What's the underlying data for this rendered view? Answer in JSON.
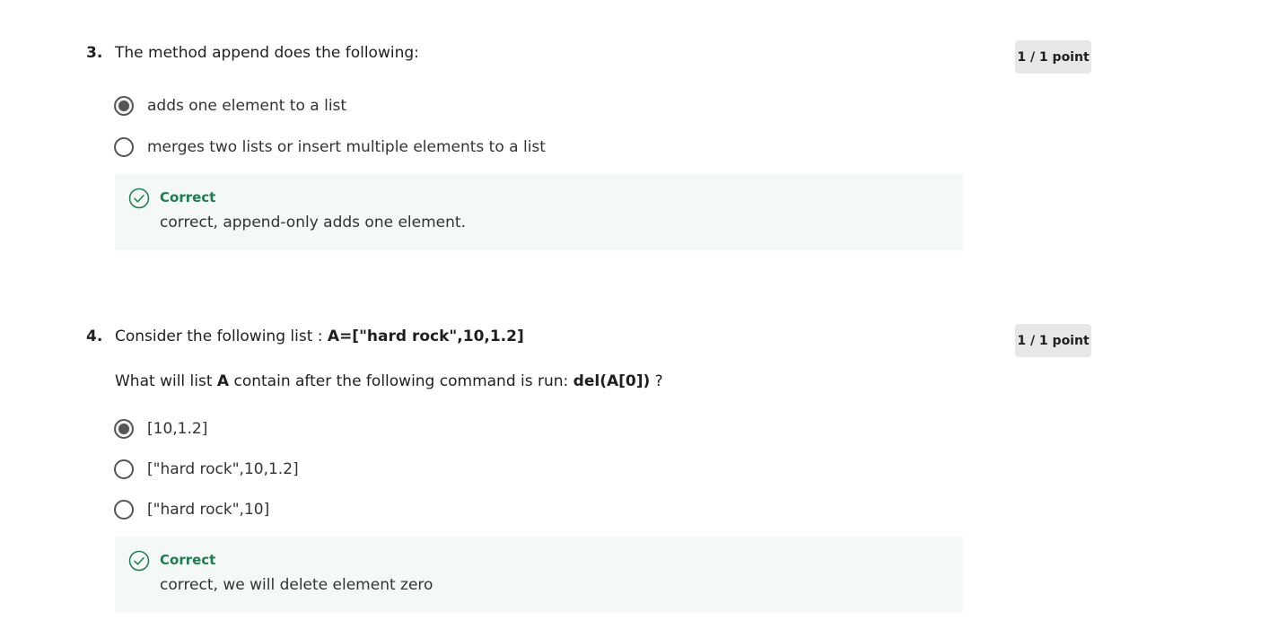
{
  "questions": [
    {
      "number": "3.",
      "prompt": "The method append does the following:",
      "points": "1 / 1 point",
      "options": [
        {
          "label": "adds one element to a list",
          "selected": true
        },
        {
          "label": "merges two lists or insert multiple elements to a list",
          "selected": false
        }
      ],
      "feedback": {
        "title": "Correct",
        "text": "correct, append-only adds one element."
      }
    },
    {
      "number": "4.",
      "prompt_prefix": "Consider the following list : ",
      "prompt_code": "A=[\"hard rock\",10,1.2]",
      "sub_prefix": "What will list ",
      "sub_var": "A",
      "sub_middle": " contain after the following command is run: ",
      "sub_code": "del(A[0])",
      "sub_suffix": " ?",
      "points": "1 / 1 point",
      "options": [
        {
          "label": "[10,1.2]",
          "selected": true
        },
        {
          "label": "[\"hard rock\",10,1.2]",
          "selected": false
        },
        {
          "label": "[\"hard rock\",10]",
          "selected": false
        }
      ],
      "feedback": {
        "title": "Correct",
        "text": "correct, we will delete element zero"
      }
    }
  ],
  "colors": {
    "correct_green": "#1d7c50",
    "feedback_bg": "#f4f8f6",
    "points_bg": "#e5e7e8"
  },
  "icons": {
    "feedback": "check-circle-icon",
    "option": "radio-icon"
  }
}
